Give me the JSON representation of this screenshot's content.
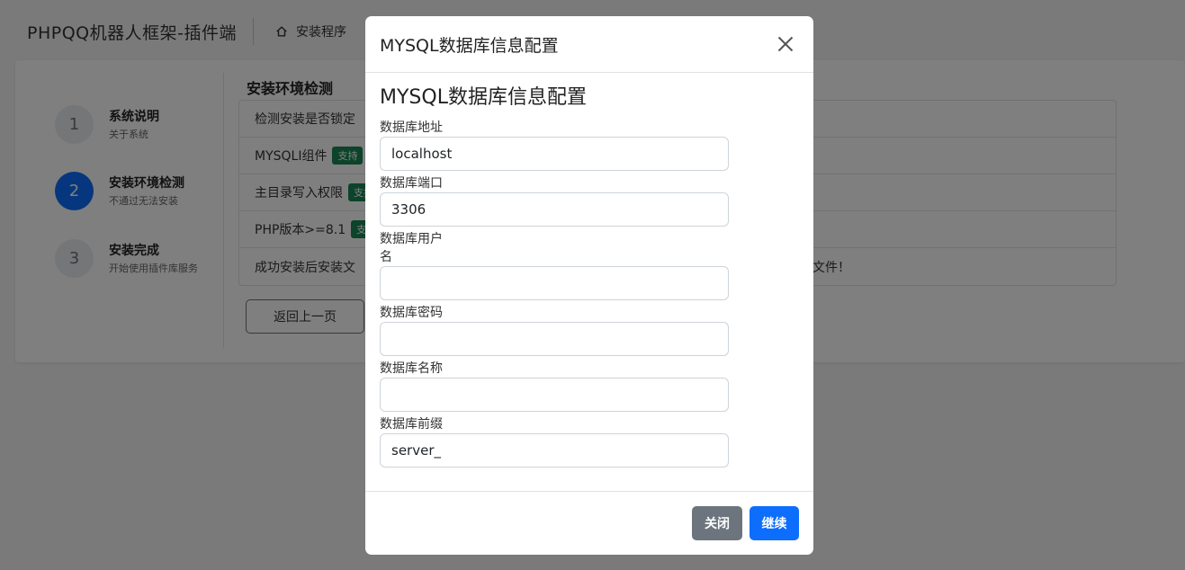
{
  "header": {
    "brand": "PHPQQ机器人框架-插件端",
    "nav_label": "安装程序"
  },
  "steps": [
    {
      "num": "1",
      "title": "系统说明",
      "subtitle": "关于系统",
      "active": false
    },
    {
      "num": "2",
      "title": "安装环境检测",
      "subtitle": "不通过无法安装",
      "active": true
    },
    {
      "num": "3",
      "title": "安装完成",
      "subtitle": "开始使用插件库服务",
      "active": false
    }
  ],
  "main": {
    "section_title": "安装环境检测",
    "checks": [
      {
        "label": "检测安装是否锁定",
        "badge": ""
      },
      {
        "label": "MYSQLI组件",
        "badge": "支持"
      },
      {
        "label": "主目录写入权限",
        "badge": "支持"
      },
      {
        "label": "PHP版本>=8.1",
        "badge": "支持"
      },
      {
        "label": "成功安装后安装文",
        "tail": "文件！",
        "badge": ""
      }
    ],
    "back_button": "返回上一页"
  },
  "modal": {
    "title": "MYSQL数据库信息配置",
    "form_heading": "MYSQL数据库信息配置",
    "fields": [
      {
        "label": "数据库地址",
        "value": "localhost"
      },
      {
        "label": "数据库端口",
        "value": "3306"
      },
      {
        "label": "数据库用户名",
        "value": ""
      },
      {
        "label": "数据库密码",
        "value": ""
      },
      {
        "label": "数据库名称",
        "value": ""
      },
      {
        "label": "数据库前缀",
        "value": "server_"
      }
    ],
    "close_button": "关闭",
    "continue_button": "继续"
  },
  "colors": {
    "primary": "#0d6efd",
    "secondary": "#6c757d",
    "success": "#198754"
  }
}
